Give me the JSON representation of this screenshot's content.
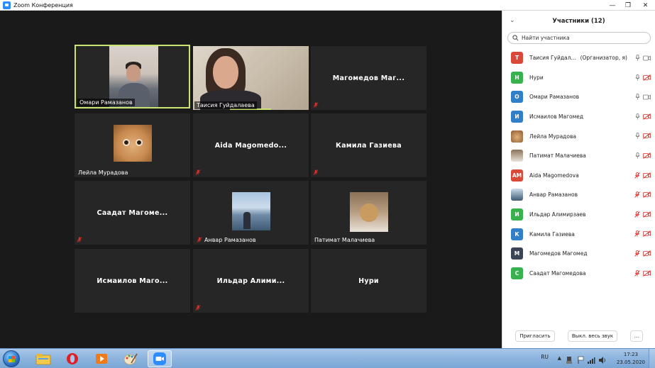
{
  "window": {
    "title": "Zoom Конференция",
    "minimize": "—",
    "restore": "❐",
    "close": "✕"
  },
  "tiles": [
    {
      "name": "Омари Рамазанов",
      "has_video": true,
      "muted": false,
      "active": true
    },
    {
      "name": "Таисия Гуйдалаева",
      "has_video": true,
      "muted": false
    },
    {
      "big_name": "Магомедов  Маг...",
      "muted": true
    },
    {
      "name": "Лейла Мурадова",
      "has_thumb": true,
      "muted": false
    },
    {
      "big_name": "Aida  Magomedo...",
      "muted": true
    },
    {
      "big_name": "Камила Газиева",
      "muted": true
    },
    {
      "big_name": "Саадат  Магоме...",
      "muted": true
    },
    {
      "name": "Анвар Рамазанов",
      "has_thumb": true,
      "muted": true
    },
    {
      "name": "Патимат Малачиева",
      "has_thumb": true,
      "muted": false
    },
    {
      "big_name": "Исмаилов  Маго...",
      "muted": false
    },
    {
      "big_name": "Ильдар  Алими...",
      "muted": true
    },
    {
      "big_name": "Нури",
      "muted": false
    }
  ],
  "panel": {
    "title": "Участники (12)",
    "search_placeholder": "Найти участника",
    "participants": [
      {
        "initials": "Т",
        "name": "Таисия Гуйдал...",
        "role": "(Организатор, я)",
        "color": "#d9493a",
        "mic": "on",
        "video": "on"
      },
      {
        "initials": "Н",
        "name": "Нури",
        "color": "#37b24d",
        "mic": "on",
        "video": "off"
      },
      {
        "initials": "О",
        "name": "Омари Рамазанов",
        "color": "#2f7fc9",
        "mic": "on",
        "video": "on"
      },
      {
        "initials": "И",
        "name": "Исмаилов Магомед",
        "color": "#2f7fc9",
        "mic": "on",
        "video": "off"
      },
      {
        "initials": "",
        "name": "Лейла Мурадова",
        "color": "#c88a4f",
        "mic": "on",
        "video": "off",
        "photo": "cat"
      },
      {
        "initials": "",
        "name": "Патимат Малачиева",
        "color": "#9b8468",
        "mic": "on",
        "video": "off",
        "photo": "cat2"
      },
      {
        "initials": "АМ",
        "name": "Aida Magomedova",
        "color": "#d9493a",
        "mic": "off",
        "video": "off"
      },
      {
        "initials": "",
        "name": "Анвар Рамазанов",
        "color": "#6f8ba6",
        "mic": "off",
        "video": "off",
        "photo": "sea"
      },
      {
        "initials": "И",
        "name": "Ильдар Алимирзаев",
        "color": "#37b24d",
        "mic": "off",
        "video": "off"
      },
      {
        "initials": "К",
        "name": "Камила Газиева",
        "color": "#2f7fc9",
        "mic": "off",
        "video": "off"
      },
      {
        "initials": "М",
        "name": "Магомедов Магомед",
        "color": "#3a4455",
        "mic": "off",
        "video": "off"
      },
      {
        "initials": "С",
        "name": "Саадат Магомедова",
        "color": "#37b24d",
        "mic": "off",
        "video": "off"
      }
    ],
    "invite_label": "Пригласить",
    "mute_all_label": "Выкл. весь звук",
    "more_label": "..."
  },
  "taskbar": {
    "lang": "RU",
    "time": "17:23",
    "date": "23.05.2020",
    "apps": [
      "explorer-icon",
      "opera-icon",
      "media-player-icon",
      "paint-icon",
      "zoom-icon"
    ]
  }
}
